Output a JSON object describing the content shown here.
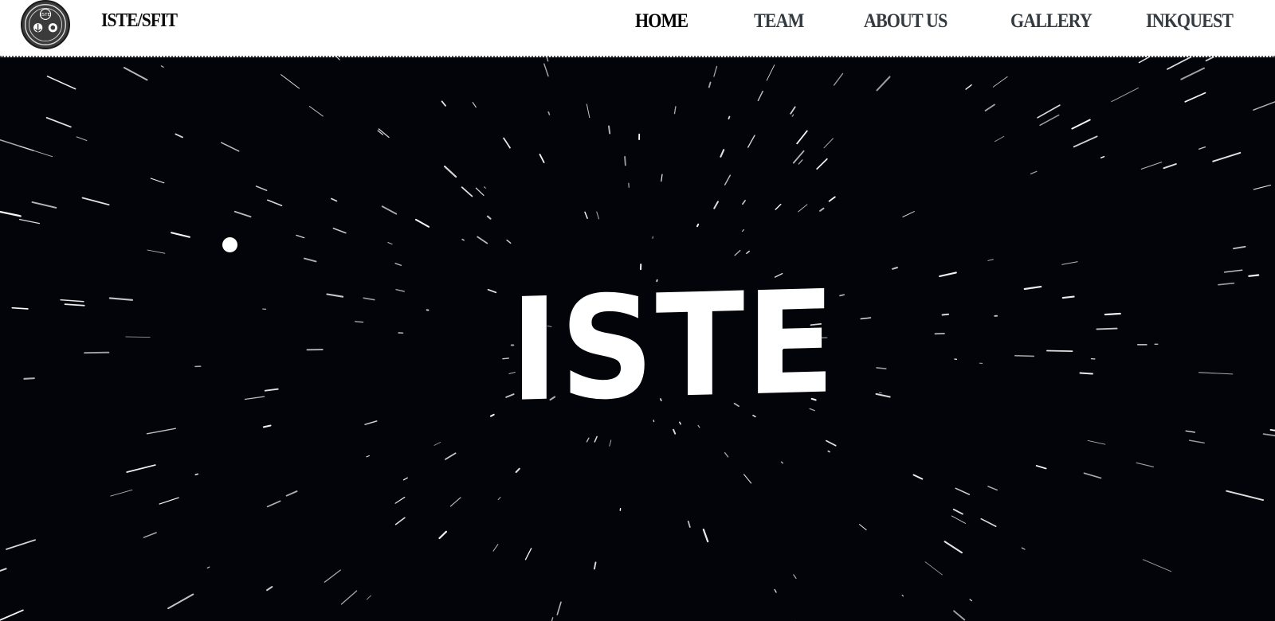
{
  "navbar": {
    "logo_text": "ISTE",
    "brand": "ISTE/SFIT",
    "items": [
      {
        "label": "HOME",
        "active": true
      },
      {
        "label": "TEAM",
        "active": false
      },
      {
        "label": "ABOUT US",
        "active": false
      },
      {
        "label": "GALLERY",
        "active": false
      },
      {
        "label": "INKQUEST",
        "active": false
      }
    ]
  },
  "hero": {
    "title": "ISTE",
    "background_color": "#02040a",
    "star_color": "#ffffff"
  }
}
